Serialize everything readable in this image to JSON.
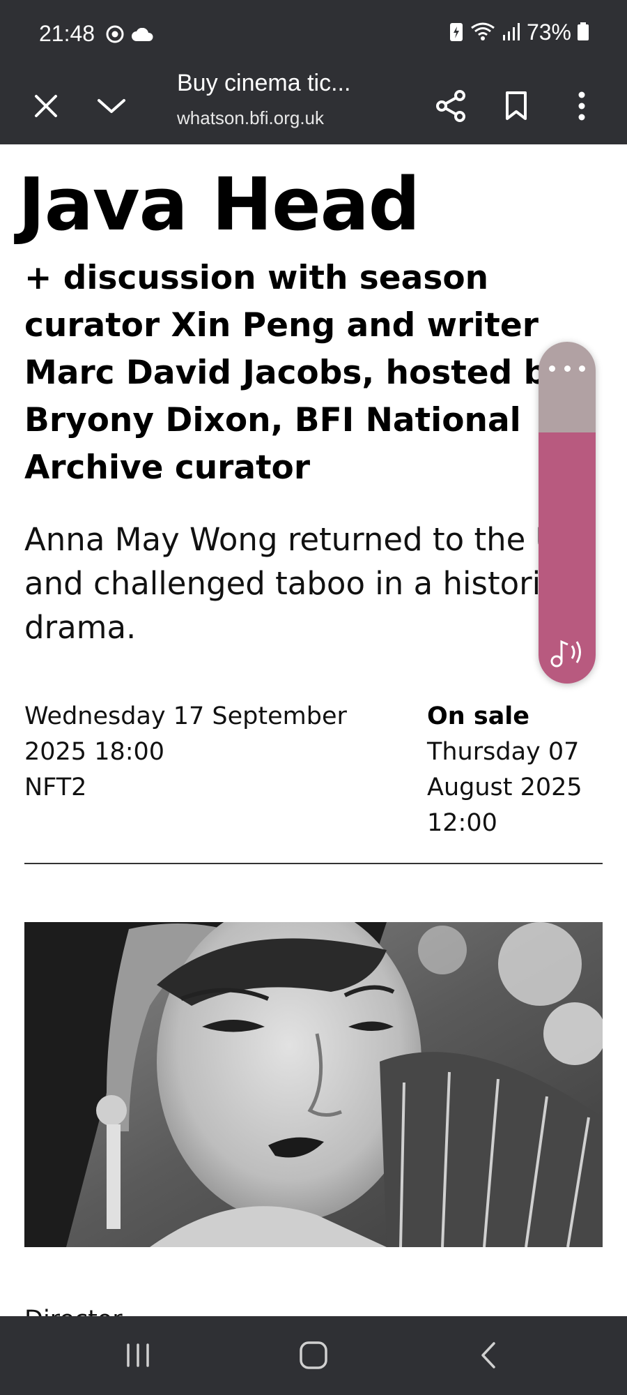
{
  "status_bar": {
    "time": "21:48",
    "battery": "73%",
    "icons": [
      "chrome-icon",
      "cloud-icon",
      "battery-saver-icon",
      "wifi-icon",
      "signal-icon",
      "battery-icon"
    ]
  },
  "browser": {
    "tab_title": "Buy cinema tic...",
    "domain": "whatson.bfi.org.uk",
    "icons": [
      "close-icon",
      "chevron-down-icon",
      "share-icon",
      "bookmark-icon",
      "more-vertical-icon"
    ]
  },
  "event": {
    "title": "Java Head",
    "subtitle_lines": [
      "+ discussion with season",
      "curator Xin Peng and writer",
      "Marc David Jacobs, hosted by",
      "Bryony Dixon, BFI National",
      "Archive curator"
    ],
    "description_lines": [
      "Anna May Wong returned to the UK",
      "and challenged taboo in a historical",
      "drama."
    ],
    "date_lines": [
      "Wednesday 17 September",
      "2025 18:00"
    ],
    "venue": "NFT2",
    "on_sale_label": "On sale",
    "on_sale_lines": [
      "Thursday 07",
      "August 2025",
      "12:00"
    ],
    "next_heading": "Director"
  },
  "media_widget": {
    "icons": [
      "more-horizontal-icon",
      "audio-icon"
    ]
  },
  "nav_bar": {
    "icons": [
      "recents-icon",
      "home-icon",
      "back-icon"
    ]
  },
  "colors": {
    "system_bar": "#2f3034",
    "widget_top": "#b1a1a3",
    "widget_body": "#b85a7f",
    "text": "#000000"
  }
}
